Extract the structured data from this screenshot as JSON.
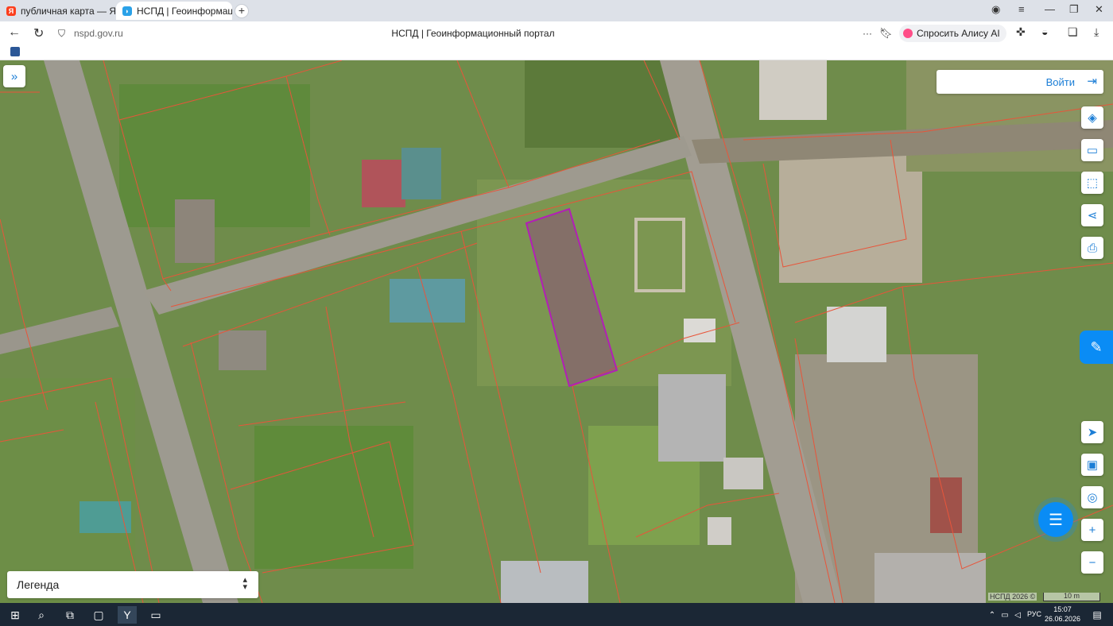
{
  "browser": {
    "tabs": [
      {
        "label": "публичная карта — Яндекс",
        "favicon": "yandex-icon",
        "active": false
      },
      {
        "label": "НСПД | Геоинформационный портал",
        "favicon": "nspd-icon",
        "active": true
      }
    ],
    "new_tab": "+",
    "url": "nspd.gov.ru",
    "page_title": "НСПД | Геоинформационный портал",
    "alisa_label": "Спросить Алису AI",
    "more": "···"
  },
  "map": {
    "login_label": "Войти",
    "legend_label": "Легенда",
    "attribution": "НСПД 2026 ©",
    "scale_label": "10 m",
    "tools": [
      "layers-icon",
      "ruler-icon",
      "select-area-icon",
      "share-icon",
      "print-icon"
    ],
    "nav_tools": [
      "locate-icon",
      "minimap-icon",
      "geo-point-icon"
    ],
    "zoom_in": "+",
    "zoom_out": "−",
    "colors": {
      "parcel_border": "#e8553a",
      "selected_parcel": "#a020a8",
      "accent": "#0a8cf5"
    }
  },
  "taskbar": {
    "lang": "РУС",
    "time": "15:07",
    "date": "26.06.2026"
  }
}
